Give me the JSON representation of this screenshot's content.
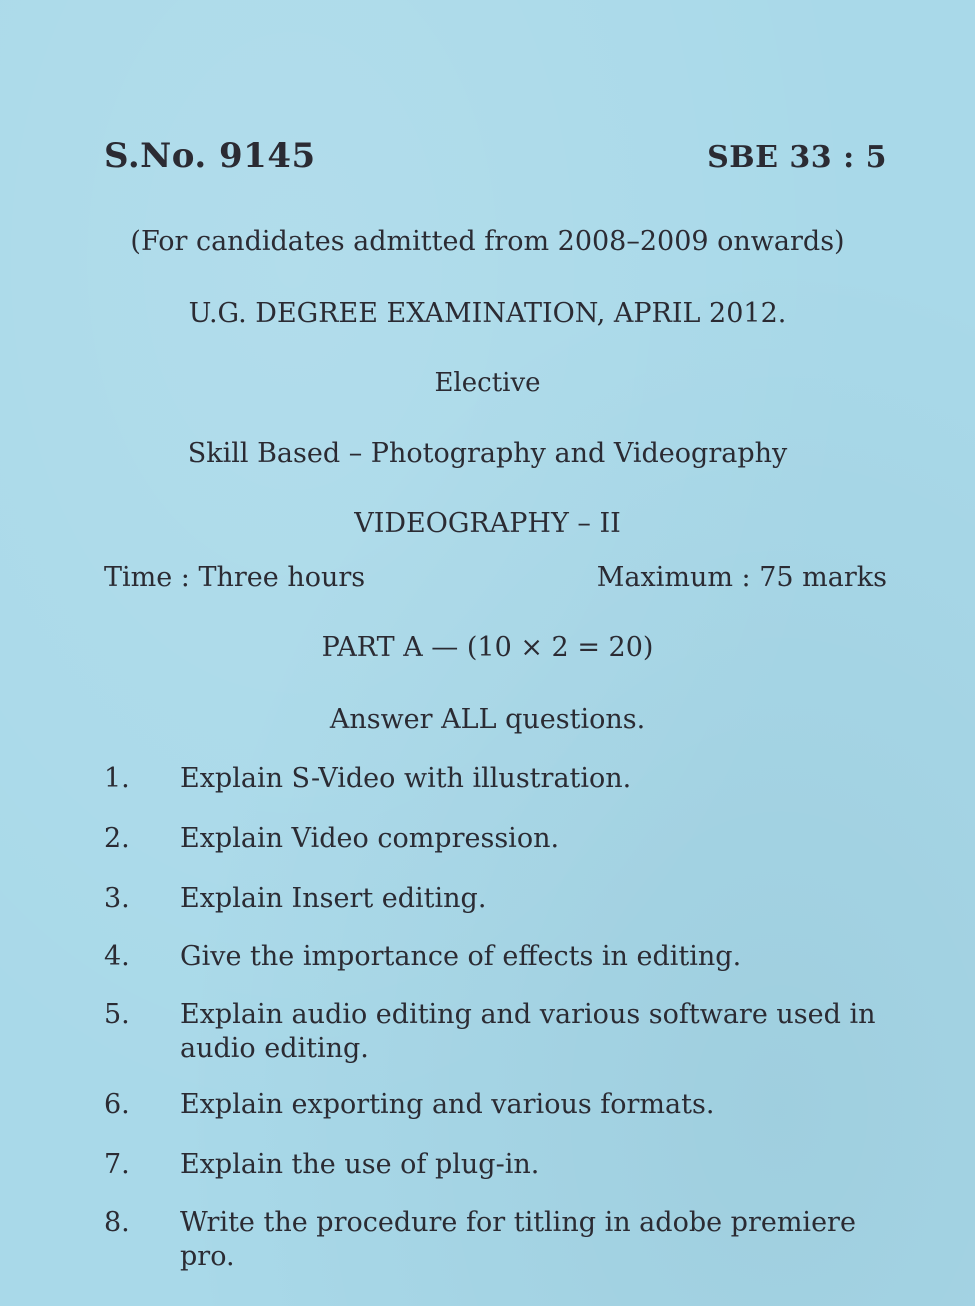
{
  "header": {
    "serial_number": "S.No. 9145",
    "paper_code": "SBE 33 : 5"
  },
  "admission_note": "(For candidates admitted from 2008–2009 onwards)",
  "exam_name": "U.G. DEGREE EXAMINATION, APRIL 2012.",
  "category": "Elective",
  "subject": "Skill Based – Photography and Videography",
  "paper_title": "VIDEOGRAPHY – II",
  "time": "Time : Three hours",
  "max_marks": "Maximum : 75 marks",
  "part": "PART A — (10 × 2 = 20)",
  "instruction": "Answer ALL questions.",
  "questions": [
    {
      "num": "1.",
      "text": "Explain S-Video with illustration."
    },
    {
      "num": "2.",
      "text": "Explain Video compression."
    },
    {
      "num": "3.",
      "text": "Explain Insert editing."
    },
    {
      "num": "4.",
      "text": "Give the importance of effects in editing."
    },
    {
      "num": "5.",
      "text": "Explain audio editing and various software used in audio editing."
    },
    {
      "num": "6.",
      "text": "Explain exporting and various formats."
    },
    {
      "num": "7.",
      "text": "Explain the use of plug-in."
    },
    {
      "num": "8.",
      "text": "Write the procedure for titling in adobe premiere pro."
    }
  ]
}
